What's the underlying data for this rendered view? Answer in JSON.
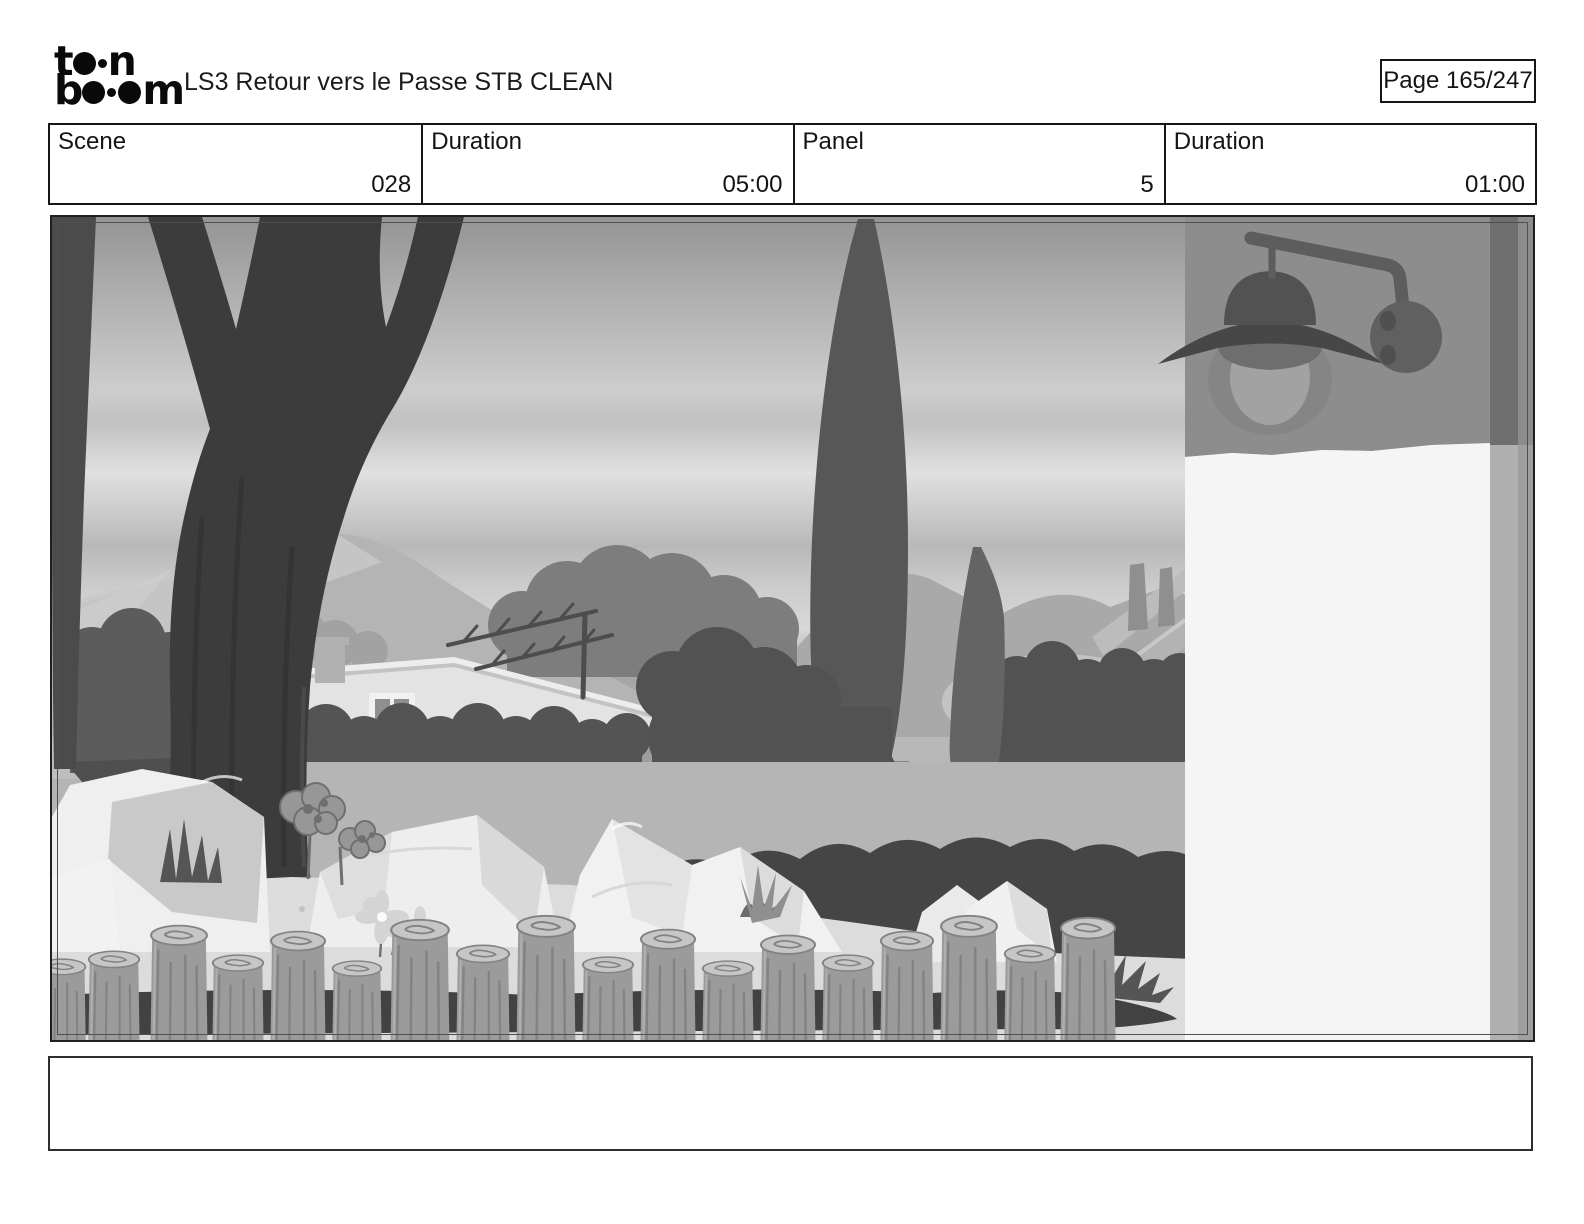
{
  "header": {
    "title": "LS3 Retour vers le Passe STB CLEAN",
    "page_label": "Page 165/247",
    "logo": {
      "alt": "toon boom",
      "t1": "t",
      "t2": "n",
      "b1": "b",
      "b2": "m"
    }
  },
  "info_table": {
    "cells": [
      {
        "label": "Scene",
        "value": "028"
      },
      {
        "label": "Duration",
        "value": "05:00"
      },
      {
        "label": "Panel",
        "value": "5"
      },
      {
        "label": "Duration",
        "value": "01:00"
      }
    ]
  },
  "panel": {
    "description": "Grayscale storyboard background: suburban backyard with bare tree, mid-century house with TV antenna, cypress trees, mountains, plank fence, white rocks, log border fence, and a wall-mounted lamp on a white wall at right.",
    "scene_elements": [
      "sky",
      "mountains",
      "bare-tree",
      "house",
      "tv-antenna",
      "cypress-trees",
      "plank-fence",
      "bushes",
      "rocks",
      "rose-bush",
      "daisies",
      "log-fence",
      "wall-lamp",
      "white-wall"
    ]
  },
  "notes": {
    "value": ""
  },
  "palette": {
    "paper": "#ffffff",
    "ink": "#141414",
    "border": "#161616",
    "sky_top": "#949494",
    "sky_light": "#e0e0e0",
    "sky_band": "#d8d8d8",
    "sky_dark": "#a6a6a6",
    "sky_horizon": "#9e9e9e",
    "mountain_main": "#b4b4b4",
    "mountain_lite": "#c8c8c8",
    "mountain_far": "#a9a9a9",
    "tree_dark": "#3c3c3c",
    "tree_slim": "#4b4b4b",
    "cypress": "#575757",
    "cypress2": "#646464",
    "bush_dark": "#545454",
    "bush_mass": "#525252",
    "bush_mid": "#5c5c5c",
    "bush_light": "#a2a2a2",
    "leafy": "#7d7d7d",
    "house_body": "#e3e3e3",
    "house_fascia": "#ededed",
    "house_shade": "#b9b9b9",
    "window_pane": "#8f8f8f",
    "antenna": "#4d4d4d",
    "plank_a": "#8f8f8f",
    "plank_b": "#9e9e9e",
    "plank_c": "#858585",
    "roof_far": "#b3b3b3",
    "chimney_far": "#8f8f8f",
    "yard": "#b5b5b5",
    "ground": "#dcdcdc",
    "darkband": "#454545",
    "mulch": "#424242",
    "rock": "#efefef",
    "rock_shade": "#c9c9c9",
    "rose": "#979797",
    "rose_dark": "#6f6f6f",
    "daisy": "#d4d4d4",
    "grass": "#555555",
    "log_body": "#9b9b9b",
    "log_top": "#c6c6c6",
    "log_ring": "#828282",
    "log_grain": "#7f7f7f",
    "lampwall": "#8d8d8d",
    "wall_white": "#f5f5f5",
    "strip": "#b0b0b0",
    "strip_dark": "#6f6f6f",
    "lamp_dark": "#474747",
    "lamp_mid": "#5d5d5d",
    "lamp_inner": "#6e6e6e",
    "lamp_bulb": "#a2a2a2",
    "lamp_glow": "#858585"
  }
}
